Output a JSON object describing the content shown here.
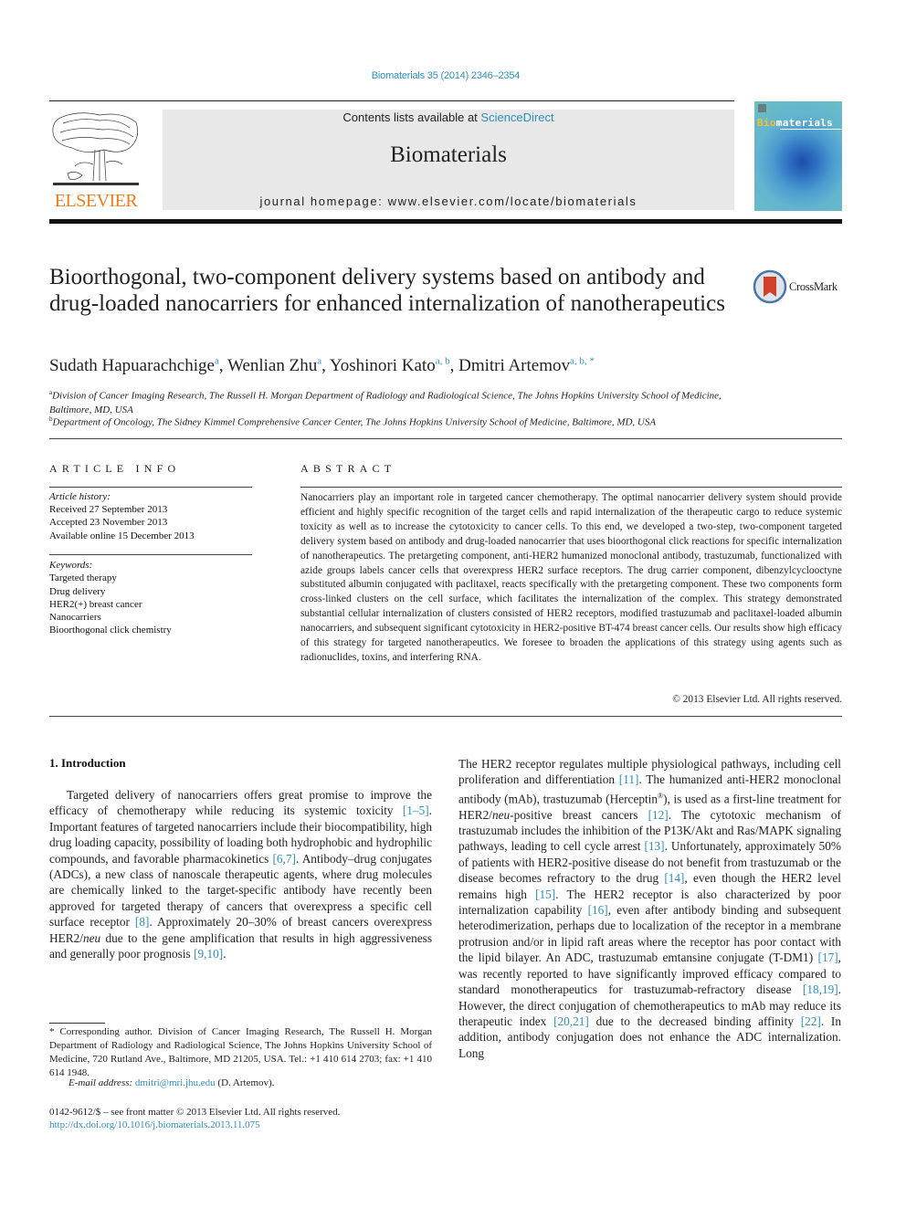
{
  "header": {
    "citation": "Biomaterials 35 (2014) 2346–2354",
    "contents_prefix": "Contents lists available at ",
    "contents_link": "ScienceDirect",
    "journal_name": "Biomaterials",
    "homepage_prefix": "journal homepage: ",
    "homepage_url": "www.elsevier.com/locate/biomaterials",
    "publisher_logo_text": "ELSEVIER",
    "cover_title_highlight": "Bio",
    "cover_title_rest": "materials"
  },
  "crossmark": {
    "label": "CrossMark"
  },
  "article": {
    "title": "Bioorthogonal, two-component delivery systems based on antibody and drug-loaded nanocarriers for enhanced internalization of nanotherapeutics",
    "authors": [
      {
        "name": "Sudath Hapuarachchige",
        "sup": "a"
      },
      {
        "name": "Wenlian Zhu",
        "sup": "a"
      },
      {
        "name": "Yoshinori Kato",
        "sup": "a, b"
      },
      {
        "name": "Dmitri Artemov",
        "sup": "a, b, *"
      }
    ],
    "affiliations": [
      {
        "label": "a",
        "text": "Division of Cancer Imaging Research, The Russell H. Morgan Department of Radiology and Radiological Science, The Johns Hopkins University School of Medicine, Baltimore, MD, USA"
      },
      {
        "label": "b",
        "text": "Department of Oncology, The Sidney Kimmel Comprehensive Cancer Center, The Johns Hopkins University School of Medicine, Baltimore, MD, USA"
      }
    ]
  },
  "article_info": {
    "heading": "ARTICLE INFO",
    "history_label": "Article history:",
    "history": [
      "Received 27 September 2013",
      "Accepted 23 November 2013",
      "Available online 15 December 2013"
    ],
    "keywords_label": "Keywords:",
    "keywords": [
      "Targeted therapy",
      "Drug delivery",
      "HER2(+) breast cancer",
      "Nanocarriers",
      "Bioorthogonal click chemistry"
    ]
  },
  "abstract": {
    "heading": "ABSTRACT",
    "text": "Nanocarriers play an important role in targeted cancer chemotherapy. The optimal nanocarrier delivery system should provide efficient and highly specific recognition of the target cells and rapid internalization of the therapeutic cargo to reduce systemic toxicity as well as to increase the cytotoxicity to cancer cells. To this end, we developed a two-step, two-component targeted delivery system based on antibody and drug-loaded nanocarrier that uses bioorthogonal click reactions for specific internalization of nanotherapeutics. The pretargeting component, anti-HER2 humanized monoclonal antibody, trastuzumab, functionalized with azide groups labels cancer cells that overexpress HER2 surface receptors. The drug carrier component, dibenzylcyclooctyne substituted albumin conjugated with paclitaxel, reacts specifically with the pretargeting component. These two components form cross-linked clusters on the cell surface, which facilitates the internalization of the complex. This strategy demonstrated substantial cellular internalization of clusters consisted of HER2 receptors, modified trastuzumab and paclitaxel-loaded albumin nanocarriers, and subsequent significant cytotoxicity in HER2-positive BT-474 breast cancer cells. Our results show high efficacy of this strategy for targeted nanotherapeutics. We foresee to broaden the applications of this strategy using agents such as radionuclides, toxins, and interfering RNA.",
    "copyright": "© 2013 Elsevier Ltd. All rights reserved."
  },
  "introduction": {
    "heading": "1.  Introduction",
    "left_segments": [
      {
        "t": "Targeted delivery of nanocarriers offers great promise to improve the efficacy of chemotherapy while reducing its systemic toxicity "
      },
      {
        "t": "[1–5]",
        "ref": true
      },
      {
        "t": ". Important features of targeted nanocarriers include their biocompatibility, high drug loading capacity, possibility of loading both hydrophobic and hydrophilic compounds, and favorable pharmacokinetics "
      },
      {
        "t": "[6,7]",
        "ref": true
      },
      {
        "t": ". Antibody–drug conjugates (ADCs), a new class of nanoscale therapeutic agents, where drug molecules are chemically linked to the target-specific antibody have recently been approved for targeted therapy of cancers that overexpress a specific cell surface receptor "
      },
      {
        "t": "[8]",
        "ref": true
      },
      {
        "t": ". Approximately 20–30% of breast cancers overexpress HER2/"
      },
      {
        "t": "neu",
        "italic": true
      },
      {
        "t": " due to the gene amplification that results in high aggressiveness and generally poor prognosis "
      },
      {
        "t": "[9,10]",
        "ref": true
      },
      {
        "t": "."
      }
    ],
    "right_segments": [
      {
        "t": "The HER2 receptor regulates multiple physiological pathways, including cell proliferation and differentiation "
      },
      {
        "t": "[11]",
        "ref": true
      },
      {
        "t": ". The humanized anti-HER2 monoclonal antibody (mAb), trastuzumab (Herceptin"
      },
      {
        "t": "®",
        "sup": true
      },
      {
        "t": "), is used as a first-line treatment for HER2/"
      },
      {
        "t": "neu",
        "italic": true
      },
      {
        "t": "-positive breast cancers "
      },
      {
        "t": "[12]",
        "ref": true
      },
      {
        "t": ". The cytotoxic mechanism of trastuzumab includes the inhibition of the P13K/Akt and Ras/MAPK signaling pathways, leading to cell cycle arrest "
      },
      {
        "t": "[13]",
        "ref": true
      },
      {
        "t": ". Unfortunately, approximately 50% of patients with HER2-positive disease do not benefit from trastuzumab or the disease becomes refractory to the drug "
      },
      {
        "t": "[14]",
        "ref": true
      },
      {
        "t": ", even though the HER2 level remains high "
      },
      {
        "t": "[15]",
        "ref": true
      },
      {
        "t": ". The HER2 receptor is also characterized by poor internalization capability "
      },
      {
        "t": "[16]",
        "ref": true
      },
      {
        "t": ", even after antibody binding and subsequent heterodimerization, perhaps due to localization of the receptor in a membrane protrusion and/or in lipid raft areas where the receptor has poor contact with the lipid bilayer. An ADC, trastuzumab emtansine conjugate (T-DM1) "
      },
      {
        "t": "[17]",
        "ref": true
      },
      {
        "t": ", was recently reported to have significantly improved efficacy compared to standard monotherapeutics for trastuzumab-refractory disease "
      },
      {
        "t": "[18,19]",
        "ref": true
      },
      {
        "t": ". However, the direct conjugation of chemotherapeutics to mAb may reduce its therapeutic index "
      },
      {
        "t": "[20,21]",
        "ref": true
      },
      {
        "t": " due to the decreased binding affinity "
      },
      {
        "t": "[22]",
        "ref": true
      },
      {
        "t": ". In addition, antibody conjugation does not enhance the ADC internalization. Long"
      }
    ]
  },
  "footnote": {
    "text": "* Corresponding author. Division of Cancer Imaging Research, The Russell H. Morgan Department of Radiology and Radiological Science, The Johns Hopkins University School of Medicine, 720 Rutland Ave., Baltimore, MD 21205, USA. Tel.: +1 410 614 2703; fax: +1 410 614 1948.",
    "email_label": "E-mail address: ",
    "email": "dmitri@mri.jhu.edu",
    "email_suffix": " (D. Artemov)."
  },
  "front_matter": {
    "issn_line": "0142-9612/$ – see front matter © 2013 Elsevier Ltd. All rights reserved.",
    "doi": "http://dx.doi.org/10.1016/j.biomaterials.2013.11.075"
  },
  "colors": {
    "link": "#2a8fbd",
    "elsevier_orange": "#f07c1a",
    "header_band": "#e8e8e8"
  }
}
